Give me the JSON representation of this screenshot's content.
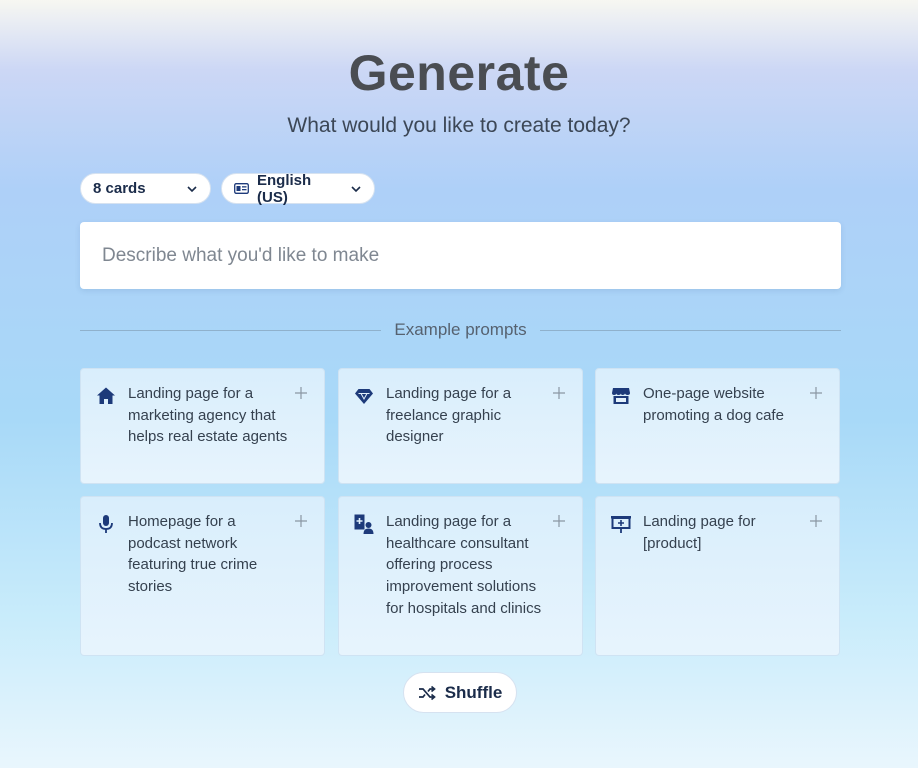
{
  "header": {
    "title": "Generate",
    "subtitle": "What would you like to create today?"
  },
  "controls": {
    "card_count": "8 cards",
    "language": "English (US)"
  },
  "prompt": {
    "placeholder": "Describe what you'd like to make",
    "value": ""
  },
  "examples": {
    "heading": "Example prompts",
    "cards": [
      {
        "icon": "house-icon",
        "text": "Landing page for a marketing agency that helps real estate agents"
      },
      {
        "icon": "gem-icon",
        "text": "Landing page for a freelance graphic designer"
      },
      {
        "icon": "store-icon",
        "text": "One-page website promoting a dog cafe"
      },
      {
        "icon": "microphone-icon",
        "text": "Homepage for a podcast network featuring true crime stories"
      },
      {
        "icon": "consultant-icon",
        "text": "Landing page for a healthcare consultant offering process improvement solutions for hospitals and clinics"
      },
      {
        "icon": "presentation-board-icon",
        "text": "Landing page for [product]"
      }
    ]
  },
  "shuffle_label": "Shuffle",
  "colors": {
    "icon": "#1d3a7a",
    "title": "#4a4d52",
    "card_bg": "#dff0fc"
  }
}
